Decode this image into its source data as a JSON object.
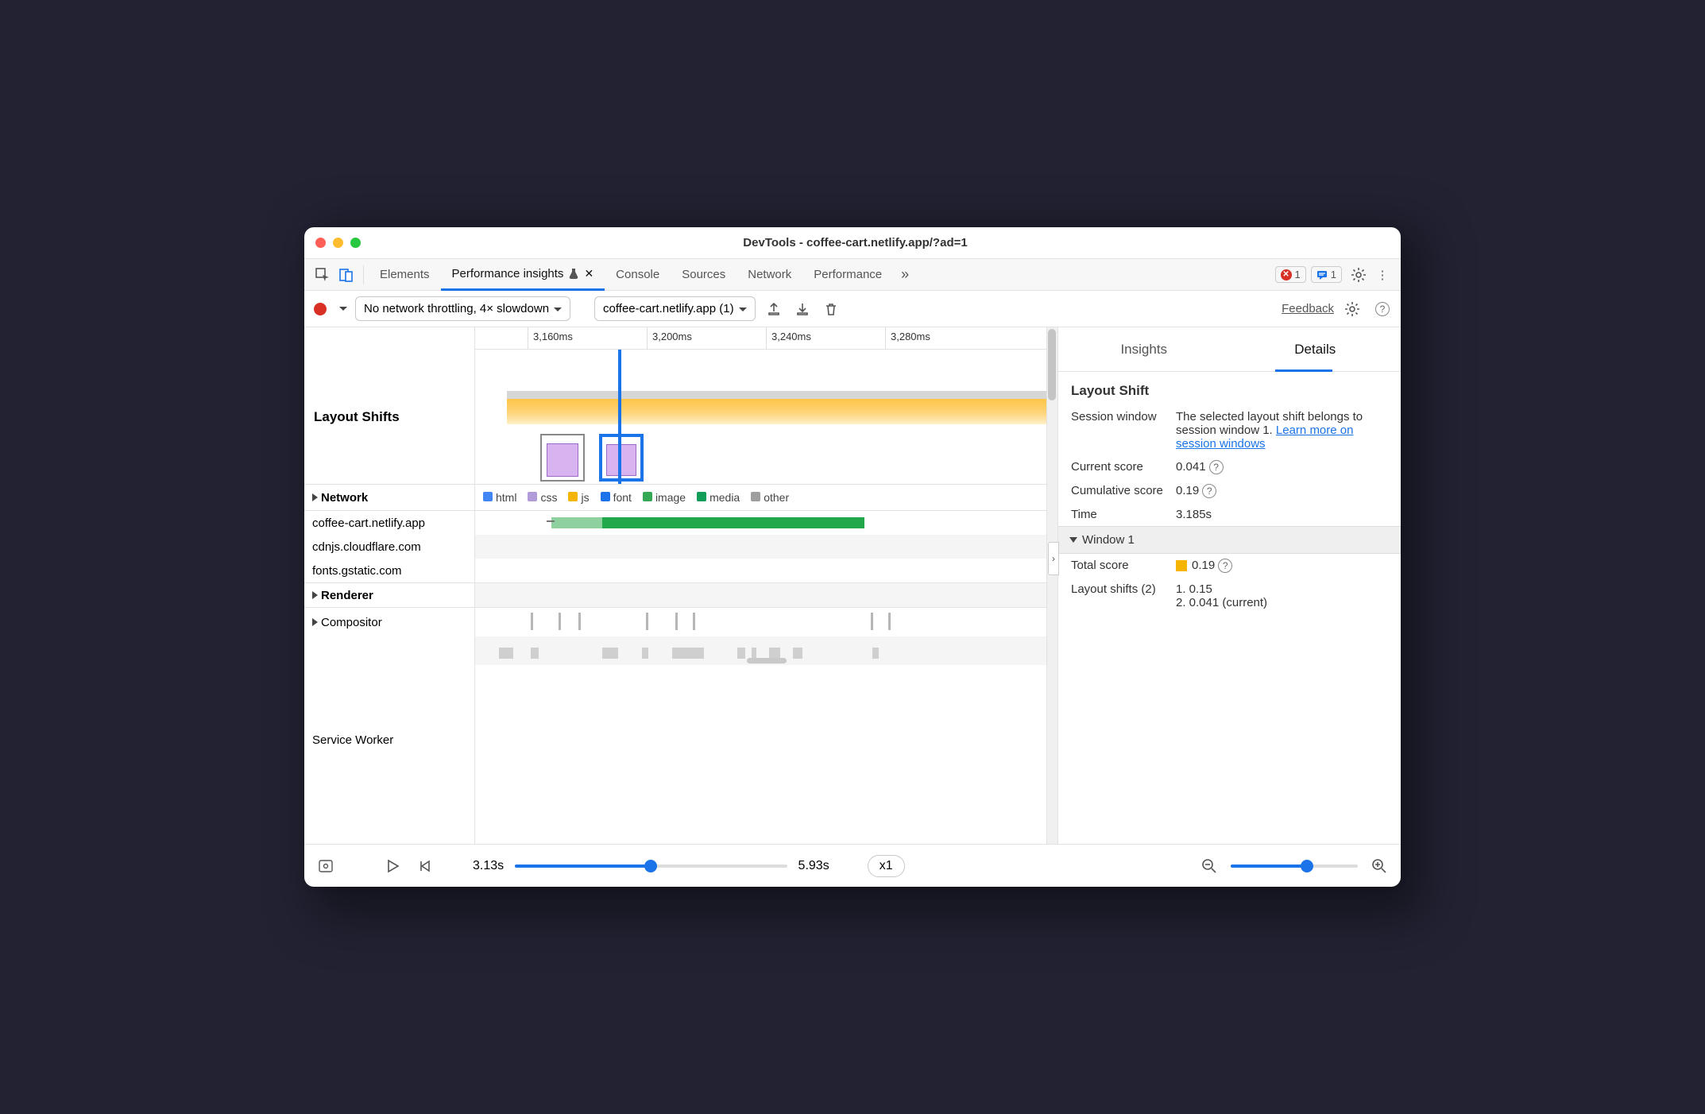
{
  "window": {
    "title": "DevTools - coffee-cart.netlify.app/?ad=1"
  },
  "tabs": {
    "elements": "Elements",
    "perf_insights": "Performance insights",
    "console": "Console",
    "sources": "Sources",
    "network": "Network",
    "performance": "Performance"
  },
  "header": {
    "error_count": "1",
    "msg_count": "1"
  },
  "toolbar": {
    "throttling": "No network throttling, 4× slowdown",
    "page_selector": "coffee-cart.netlify.app (1)",
    "feedback": "Feedback"
  },
  "ruler": {
    "t0": "3,160ms",
    "t1": "3,200ms",
    "t2": "3,240ms",
    "t3": "3,280ms"
  },
  "tracks": {
    "layout_shifts": "Layout Shifts",
    "network": "Network",
    "renderer": "Renderer",
    "compositor": "Compositor",
    "service_worker": "Service Worker"
  },
  "legend": {
    "html": "html",
    "css": "css",
    "js": "js",
    "font": "font",
    "image": "image",
    "media": "media",
    "other": "other"
  },
  "net_domains": {
    "d0": "coffee-cart.netlify.app",
    "d1": "cdnjs.cloudflare.com",
    "d2": "fonts.gstatic.com"
  },
  "side": {
    "tab_insights": "Insights",
    "tab_details": "Details",
    "title": "Layout Shift",
    "k_session": "Session window",
    "v_session_pre": "The selected layout shift belongs to session window 1. ",
    "v_session_link": "Learn more on session windows",
    "k_current": "Current score",
    "v_current": "0.041",
    "k_cumulative": "Cumulative score",
    "v_cumulative": "0.19",
    "k_time": "Time",
    "v_time": "3.185s",
    "window_hdr": "Window 1",
    "k_total": "Total score",
    "v_total": "0.19",
    "k_shifts": "Layout shifts (2)",
    "v_shift1": "1. 0.15",
    "v_shift2": "2. 0.041 (current)"
  },
  "footer": {
    "start": "3.13s",
    "end": "5.93s",
    "speed": "x1"
  }
}
